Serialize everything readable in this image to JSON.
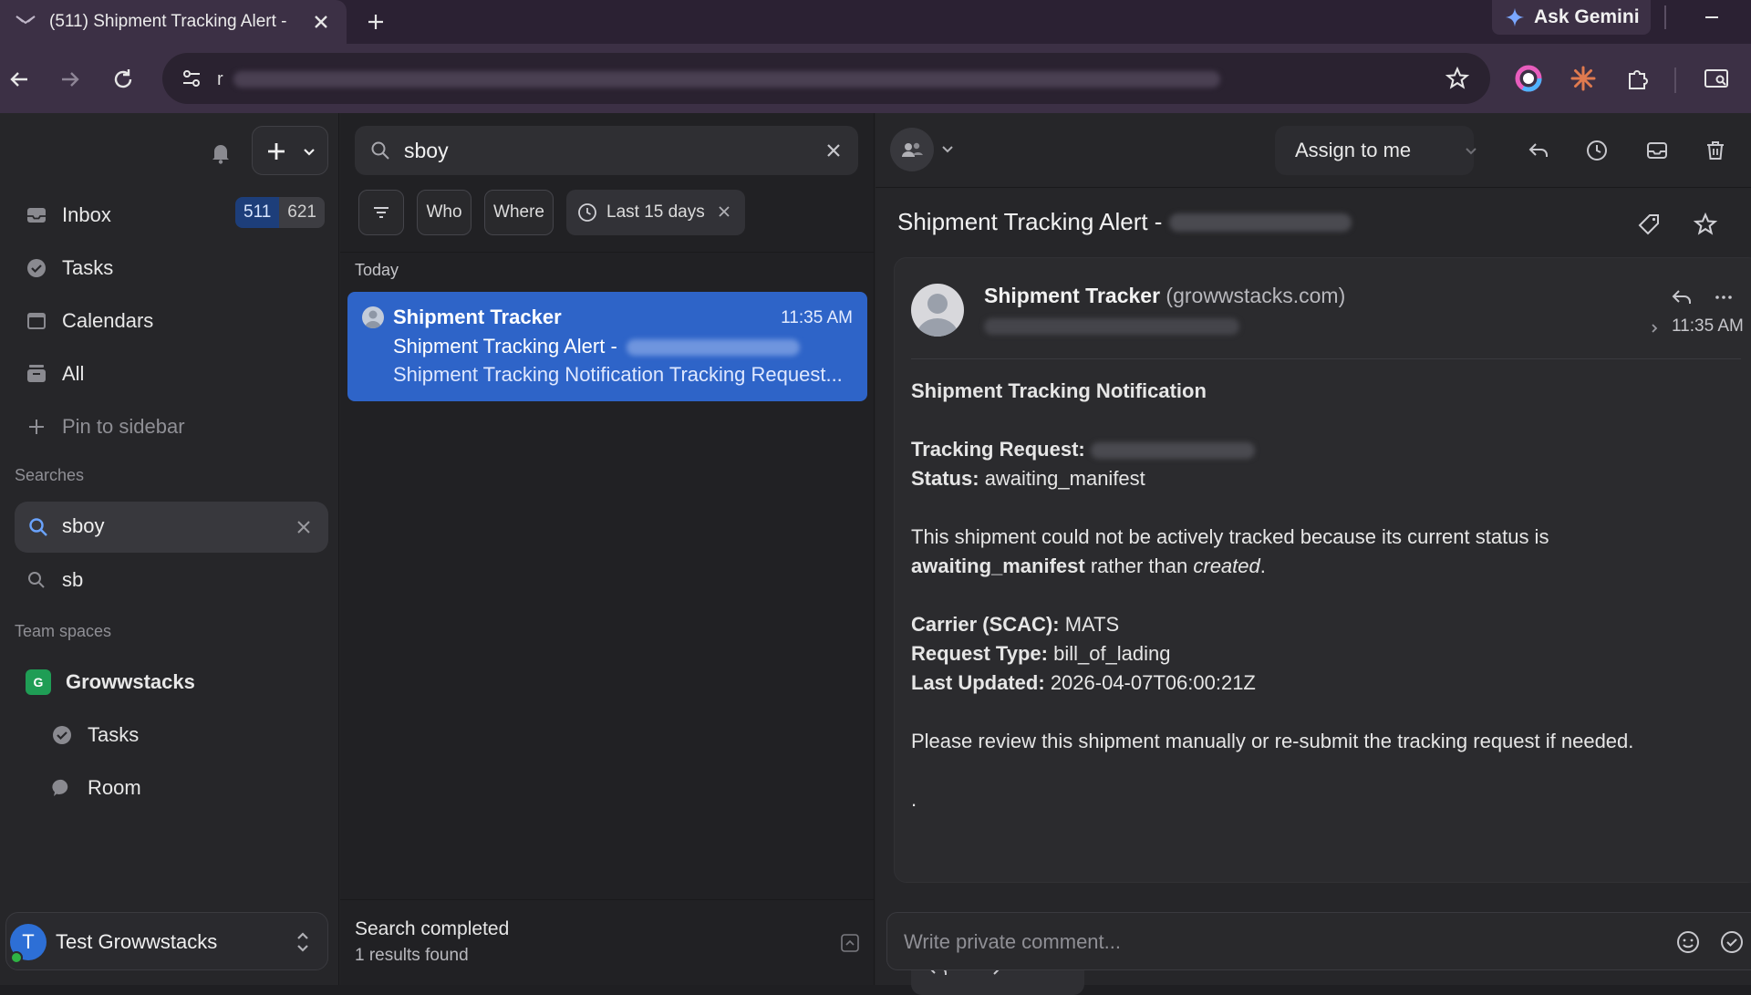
{
  "browser": {
    "tab_title": "(511) Shipment Tracking Alert -",
    "url_prefix": "r",
    "ask_gemini": "Ask Gemini"
  },
  "sidebar": {
    "nav": [
      {
        "label": "Inbox",
        "icon": "inbox-icon"
      },
      {
        "label": "Tasks",
        "icon": "check-circle-icon"
      },
      {
        "label": "Calendars",
        "icon": "calendar-icon"
      },
      {
        "label": "All",
        "icon": "stack-icon"
      }
    ],
    "inbox_unread": "511",
    "inbox_total": "621",
    "pin_label": "Pin to sidebar",
    "searches_heading": "Searches",
    "searches": [
      "sboy",
      "sb"
    ],
    "team_spaces_heading": "Team spaces",
    "team": {
      "name": "Growwstacks",
      "badge": "G",
      "children": [
        {
          "label": "Tasks",
          "icon": "check-circle-icon"
        },
        {
          "label": "Room",
          "icon": "chat-bubble-icon"
        }
      ]
    },
    "user": {
      "initial": "T",
      "name": "Test Growwstacks"
    }
  },
  "list": {
    "search_value": "sboy",
    "filters": {
      "who": "Who",
      "where": "Where",
      "date": "Last 15 days"
    },
    "group_label": "Today",
    "messages": [
      {
        "sender": "Shipment Tracker",
        "time": "11:35 AM",
        "subject": "Shipment Tracking Alert -",
        "preview": "Shipment Tracking Notification Tracking Request..."
      }
    ],
    "status_title": "Search completed",
    "status_count": "1 results found"
  },
  "reader": {
    "assign_label": "Assign to me",
    "subject": "Shipment Tracking Alert -",
    "from_name": "Shipment Tracker",
    "from_domain": "(growwstacks.com)",
    "time": "11:35 AM",
    "body": {
      "heading": "Shipment Tracking Notification",
      "tracking_request_label": "Tracking Request:",
      "status_label": "Status:",
      "status_value": "awaiting_manifest",
      "explain_prefix": "This shipment could not be actively tracked because its current status is",
      "explain_bold": "awaiting_manifest",
      "explain_mid": "rather than",
      "explain_italic": "created",
      "explain_end": ".",
      "carrier_label": "Carrier (SCAC):",
      "carrier_value": "MATS",
      "request_type_label": "Request Type:",
      "request_type_value": "bill_of_lading",
      "last_updated_label": "Last Updated:",
      "last_updated_value": "2026-04-07T06:00:21Z",
      "closing": "Please review this shipment manually or re-submit the tracking request if needed.",
      "trailing": "."
    },
    "comment_placeholder": "Write private comment..."
  },
  "colors": {
    "accent": "#2e64c8",
    "browser_frame": "#3c3045",
    "online": "#2fb344",
    "team_badge": "#1f9d55"
  }
}
